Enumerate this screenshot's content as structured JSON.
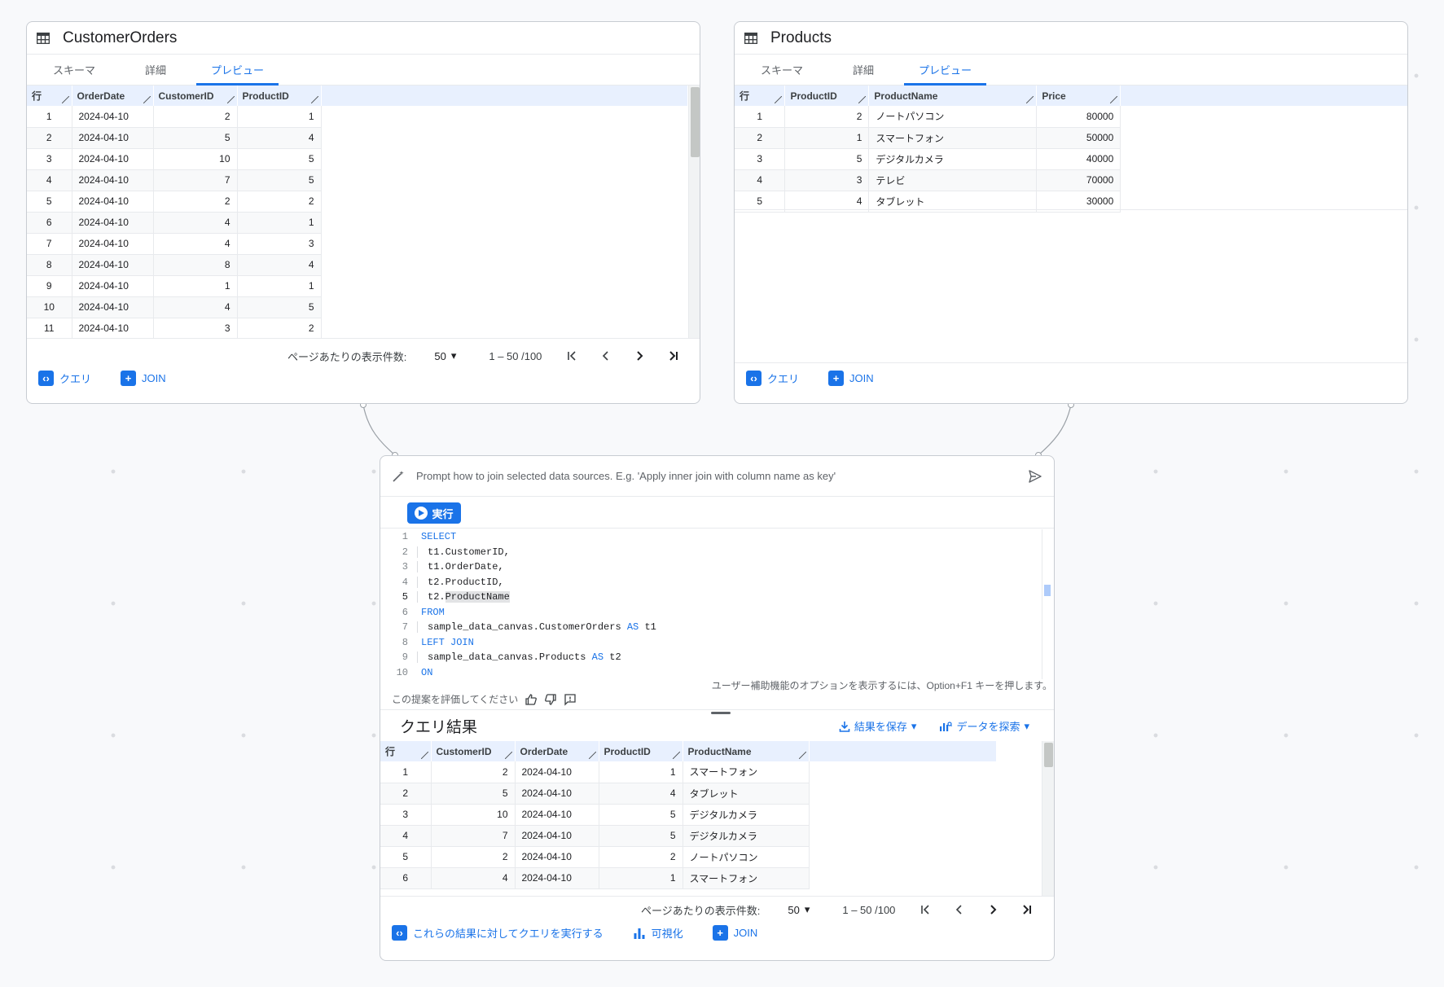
{
  "orders_card": {
    "title": "CustomerOrders",
    "tabs": [
      "スキーマ",
      "詳細",
      "プレビュー"
    ],
    "active_tab": "プレビュー",
    "columns": [
      "行",
      "OrderDate",
      "CustomerID",
      "ProductID"
    ],
    "rows": [
      [
        "1",
        "2024-04-10",
        "2",
        "1"
      ],
      [
        "2",
        "2024-04-10",
        "5",
        "4"
      ],
      [
        "3",
        "2024-04-10",
        "10",
        "5"
      ],
      [
        "4",
        "2024-04-10",
        "7",
        "5"
      ],
      [
        "5",
        "2024-04-10",
        "2",
        "2"
      ],
      [
        "6",
        "2024-04-10",
        "4",
        "1"
      ],
      [
        "7",
        "2024-04-10",
        "4",
        "3"
      ],
      [
        "8",
        "2024-04-10",
        "8",
        "4"
      ],
      [
        "9",
        "2024-04-10",
        "1",
        "1"
      ],
      [
        "10",
        "2024-04-10",
        "4",
        "5"
      ],
      [
        "11",
        "2024-04-10",
        "3",
        "2"
      ]
    ],
    "pager": {
      "label": "ページあたりの表示件数:",
      "page_size": "50",
      "range": "1 – 50 /100"
    },
    "actions": {
      "query": "クエリ",
      "join": "JOIN"
    }
  },
  "products_card": {
    "title": "Products",
    "tabs": [
      "スキーマ",
      "詳細",
      "プレビュー"
    ],
    "active_tab": "プレビュー",
    "columns": [
      "行",
      "ProductID",
      "ProductName",
      "Price"
    ],
    "rows": [
      [
        "1",
        "2",
        "ノートパソコン",
        "80000"
      ],
      [
        "2",
        "1",
        "スマートフォン",
        "50000"
      ],
      [
        "3",
        "5",
        "デジタルカメラ",
        "40000"
      ],
      [
        "4",
        "3",
        "テレビ",
        "70000"
      ],
      [
        "5",
        "4",
        "タブレット",
        "30000"
      ]
    ],
    "actions": {
      "query": "クエリ",
      "join": "JOIN"
    }
  },
  "join_card": {
    "prompt_placeholder": "Prompt how to join selected data sources. E.g. 'Apply inner join with column name as key'",
    "run_label": "実行",
    "code_lines": [
      {
        "n": "1",
        "text": "SELECT",
        "kw": true,
        "indent": false
      },
      {
        "n": "2",
        "text": "t1.CustomerID,",
        "kw": false,
        "indent": true
      },
      {
        "n": "3",
        "text": "t1.OrderDate,",
        "kw": false,
        "indent": true
      },
      {
        "n": "4",
        "text": "t2.ProductID,",
        "kw": false,
        "indent": true
      },
      {
        "n": "5",
        "text": "t2.ProductName",
        "kw": false,
        "indent": true
      },
      {
        "n": "6",
        "text": "FROM",
        "kw": true,
        "indent": false
      },
      {
        "n": "7",
        "text": "sample_data_canvas.CustomerOrders AS t1",
        "kw": false,
        "indent": true
      },
      {
        "n": "8",
        "text": "LEFT JOIN",
        "kw": true,
        "indent": false
      },
      {
        "n": "9",
        "text": "sample_data_canvas.Products AS t2",
        "kw": false,
        "indent": true
      },
      {
        "n": "10",
        "text": "ON",
        "kw": true,
        "indent": false
      }
    ],
    "accessibility_hint": "ユーザー補助機能のオプションを表示するには、Option+F1 キーを押します。",
    "rate_label": "この提案を評価してください",
    "results_title": "クエリ結果",
    "save_results": "結果を保存",
    "explore_data": "データを探索",
    "columns": [
      "行",
      "CustomerID",
      "OrderDate",
      "ProductID",
      "ProductName"
    ],
    "rows": [
      [
        "1",
        "2",
        "2024-04-10",
        "1",
        "スマートフォン"
      ],
      [
        "2",
        "5",
        "2024-04-10",
        "4",
        "タブレット"
      ],
      [
        "3",
        "10",
        "2024-04-10",
        "5",
        "デジタルカメラ"
      ],
      [
        "4",
        "7",
        "2024-04-10",
        "5",
        "デジタルカメラ"
      ],
      [
        "5",
        "2",
        "2024-04-10",
        "2",
        "ノートパソコン"
      ],
      [
        "6",
        "4",
        "2024-04-10",
        "1",
        "スマートフォン"
      ]
    ],
    "pager": {
      "label": "ページあたりの表示件数:",
      "page_size": "50",
      "range": "1 – 50 /100"
    },
    "actions": {
      "run_on_results": "これらの結果に対してクエリを実行する",
      "visualize": "可視化",
      "join": "JOIN"
    }
  },
  "colors": {
    "accent": "#1a73e8",
    "header_bg": "#e8f0fe",
    "canvas_bg": "#f8f9fb"
  }
}
